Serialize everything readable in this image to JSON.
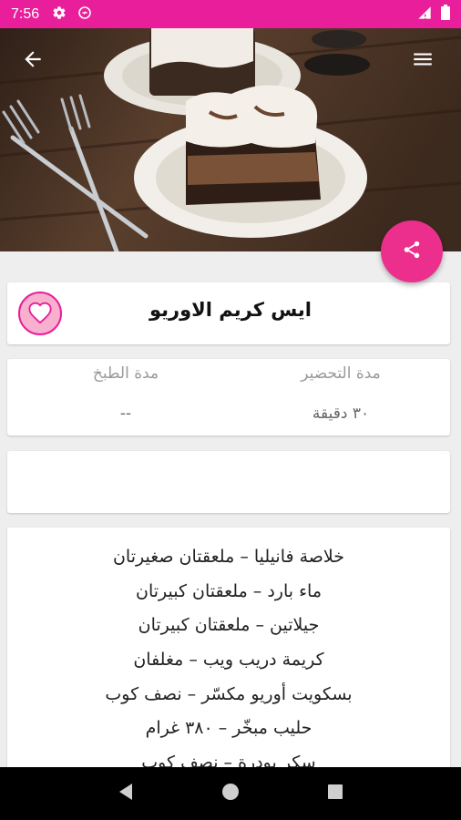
{
  "status_bar": {
    "time": "7:56"
  },
  "recipe": {
    "title": "ايس كريم الاوريو"
  },
  "times": {
    "prep_label": "مدة التحضير",
    "prep_value": "٣٠ دقيقة",
    "cook_label": "مدة الطبخ",
    "cook_value": "--"
  },
  "ingredients": [
    "خلاصة فانيليا – ملعقتان صغيرتان",
    "ماء بارد – ملعقتان كبيرتان",
    "جيلاتين – ملعقتان كبيرتان",
    "كريمة دريب ويب – مغلفان",
    "بسكويت أوريو مكسّر – نصف كوب",
    "حليب مبخّر – ٣٨٠ غرام",
    "سكر بودرة – نصف كوب"
  ],
  "colors": {
    "status_bar": "#e91e9a",
    "fab": "#ec2f8c",
    "favorite_fill": "#f7b1cf"
  },
  "icons": {
    "back": "arrow-left-icon",
    "menu": "hamburger-menu-icon",
    "share": "share-icon",
    "favorite": "heart-icon"
  }
}
